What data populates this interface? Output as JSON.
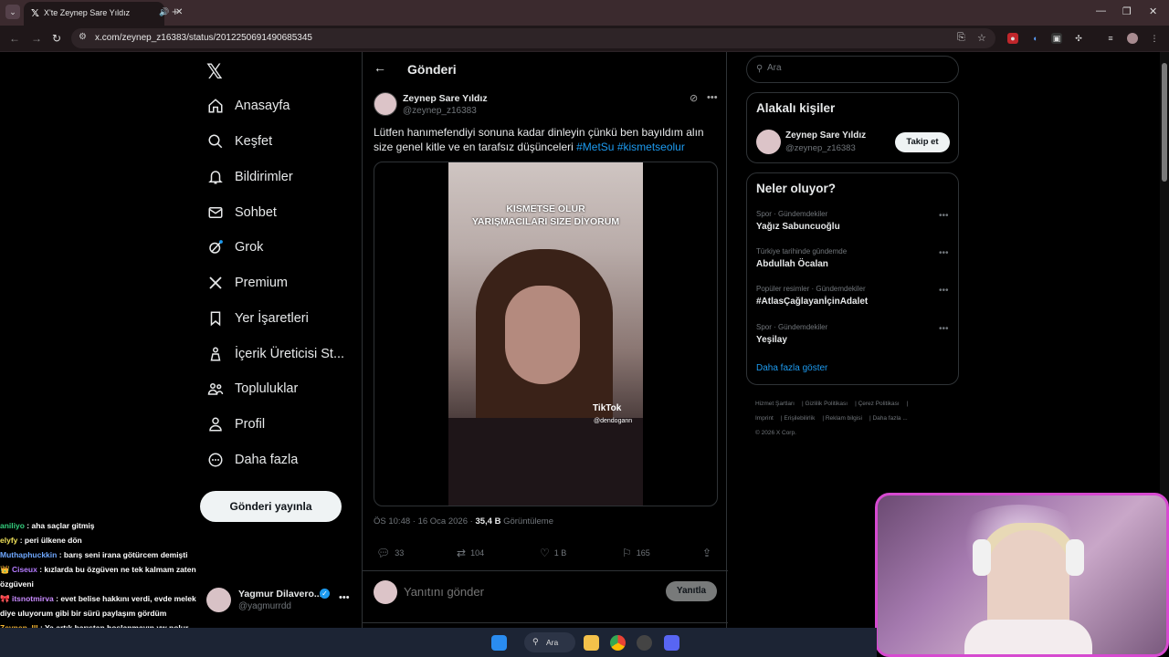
{
  "browser": {
    "tab_title": "X'te Zeynep Sare Yıldız: \"Lü",
    "url": "x.com/zeynep_z16383/status/2012250691490685345"
  },
  "nav": {
    "items": [
      {
        "label": "Anasayfa",
        "icon": "home-icon"
      },
      {
        "label": "Keşfet",
        "icon": "search-icon"
      },
      {
        "label": "Bildirimler",
        "icon": "bell-icon"
      },
      {
        "label": "Sohbet",
        "icon": "mail-icon"
      },
      {
        "label": "Grok",
        "icon": "grok-icon"
      },
      {
        "label": "Premium",
        "icon": "x-icon"
      },
      {
        "label": "Yer İşaretleri",
        "icon": "bookmark-icon"
      },
      {
        "label": "İçerik Üreticisi St...",
        "icon": "creator-icon"
      },
      {
        "label": "Topluluklar",
        "icon": "communities-icon"
      },
      {
        "label": "Profil",
        "icon": "person-icon"
      },
      {
        "label": "Daha fazla",
        "icon": "more-circle-icon"
      }
    ],
    "post_button": "Gönderi yayınla",
    "account": {
      "name": "Yagmur Dilavero...",
      "handle": "@yagmurrdd"
    }
  },
  "main": {
    "header": "Gönderi",
    "post": {
      "author": "Zeynep Sare Yıldız",
      "handle": "@zeynep_z16383",
      "text": "Lütfen hanımefendiyi sonuna kadar dinleyin çünkü ben bayıldım alın size genel kitle ve en tarafsız düşünceleri ",
      "hashtag1": "#MetSu",
      "hashtag2": "#kismetseolur",
      "video_caption_1": "KISMETSE OLUR",
      "video_caption_2": "YARIŞMACILARI SIZE DİYORUM",
      "tiktok_label": "TikTok",
      "tiktok_user": "@dendogann",
      "timestamp": "ÖS 10:48 · 16 Oca 2026 · ",
      "views_count": "35,4 B",
      "views_label": " Görüntüleme",
      "replies": "33",
      "reposts": "104",
      "likes": "1 B",
      "bookmarks": "165"
    },
    "reply_placeholder": "Yanıtını gönder",
    "reply_button": "Yanıtla"
  },
  "sidebar": {
    "search_placeholder": "Ara",
    "related_title": "Alakalı kişiler",
    "related": {
      "name": "Zeynep Sare Yıldız",
      "handle": "@zeynep_z16383",
      "follow": "Takip et"
    },
    "trends_title": "Neler oluyor?",
    "trends": [
      {
        "context": "Spor · Gündemdekiler",
        "name": "Yağız Sabuncuoğlu"
      },
      {
        "context": "Türkiye tarihinde gündemde",
        "name": "Abdullah Öcalan"
      },
      {
        "context": "Popüler resimler · Gündemdekiler",
        "name": "#AtlasÇağlayanİçinAdalet"
      },
      {
        "context": "Spor · Gündemdekiler",
        "name": "Yeşilay"
      }
    ],
    "show_more": "Daha fazla göster",
    "footer": [
      "Hizmet Şartları",
      "Gizlilik Politikası",
      "Çerez Politikası",
      "Imprint",
      "Erişilebilirlik",
      "Reklam bilgisi",
      "Daha fazla ...",
      "© 2026 X Corp."
    ]
  },
  "chat": [
    {
      "user": "aniliyo",
      "msg": " : aha saçlar gitmiş",
      "color": "#35d07f"
    },
    {
      "user": "elyfy",
      "msg": " : peri ülkene dön",
      "color": "#f2e35a"
    },
    {
      "user": "Muthaphuckkin",
      "msg": " : barış seni irana götürcem demişti",
      "color": "#6fa8ff"
    },
    {
      "user": "Ciseux",
      "msg": " : kızlarda bu özgüven ne tek kalmam zaten özgüveni",
      "color": "#b57bff"
    },
    {
      "user": "itsnotmirva",
      "msg": " : evet belise hakkını verdi, evde melek diye uluyorum gibi bir sürü paylaşım gördüm",
      "color": "#c98bff"
    },
    {
      "user": "Zeynep_lll",
      "msg": " : Ya artık barıştan hoşlanmayın yw nolur",
      "color": "#f7b733"
    }
  ],
  "taskbar": {
    "search_label": "Ara"
  }
}
